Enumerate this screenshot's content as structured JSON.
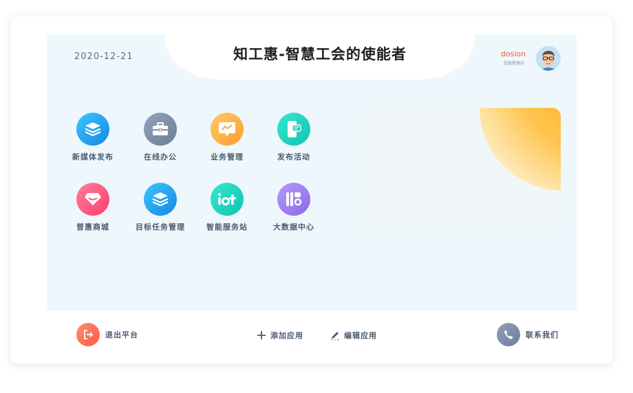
{
  "header": {
    "date": "2020-12-21",
    "title": "知工惠-智慧工会的使能者",
    "user_name": "dosion",
    "user_role": "超级管理员"
  },
  "apps": [
    {
      "label": "新媒体发布",
      "icon": "layers-icon",
      "color": "#1da6f0"
    },
    {
      "label": "在线办公",
      "icon": "briefcase-icon",
      "color": "#7d8fa8"
    },
    {
      "label": "业务管理",
      "icon": "monitor-chart-icon",
      "color": "#ffb44a"
    },
    {
      "label": "发布活动",
      "icon": "phone-card-icon",
      "color": "#1ad8bf"
    },
    {
      "label": "普惠商城",
      "icon": "gem-icon",
      "color": "#ff5b82"
    },
    {
      "label": "目标任务管理",
      "icon": "layers-icon",
      "color": "#1da6f0"
    },
    {
      "label": "智能服务站",
      "icon": "iot-icon",
      "color": "#1ad8bf"
    },
    {
      "label": "大数据中心",
      "icon": "data-bars-icon",
      "color": "#9c82ef"
    }
  ],
  "footer": {
    "logout": "退出平台",
    "add_app": "添加应用",
    "edit_app": "编辑应用",
    "contact": "联系我们"
  }
}
